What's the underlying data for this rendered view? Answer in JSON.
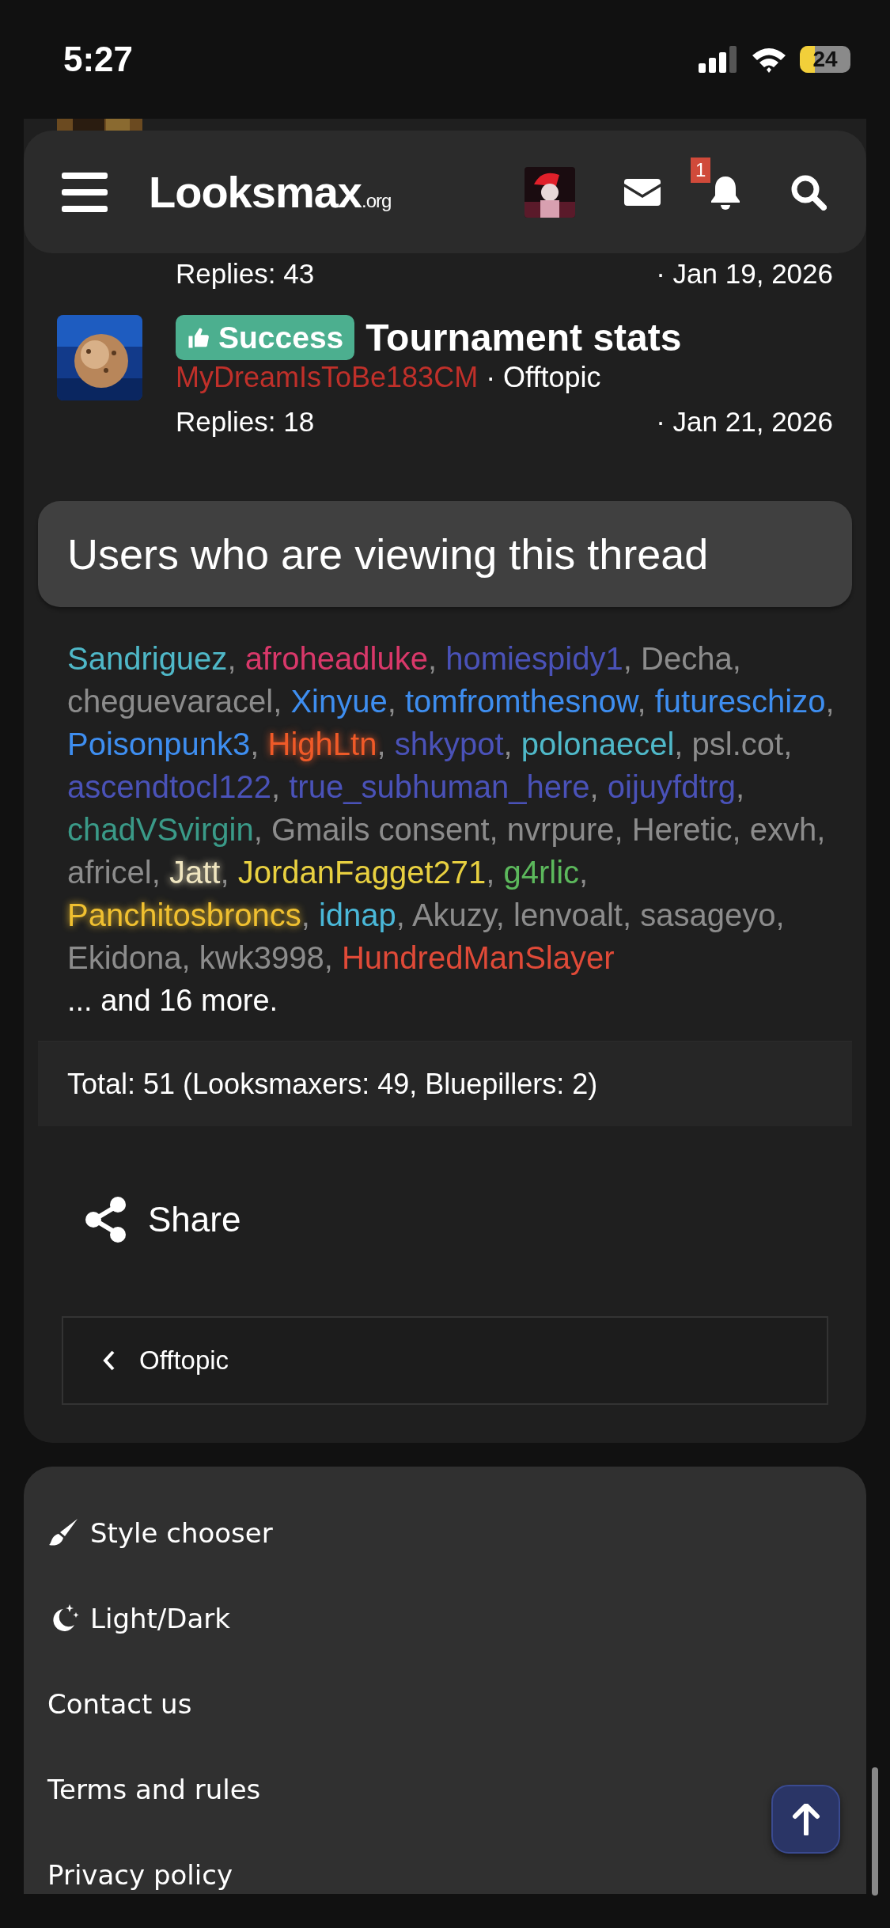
{
  "status_bar": {
    "time": "5:27",
    "battery": "24"
  },
  "header": {
    "logo": "Looksmax",
    "logo_suffix": ".org",
    "notification_count": "1"
  },
  "threads": [
    {
      "replies": "Replies: 43",
      "date": "· Jan 19, 2026"
    },
    {
      "badge": {
        "kind": "success",
        "label": "Success"
      },
      "title": "Tournament stats",
      "author": "MyDreamIsToBe183CM",
      "forum": "· Offtopic",
      "replies": "Replies: 18",
      "date": "· Jan 21, 2026"
    }
  ],
  "users_viewing": {
    "title": "Users who are viewing this thread",
    "separator": ",",
    "users": [
      {
        "name": "Sandriguez",
        "color": "#4fb8c8",
        "glow": false
      },
      {
        "name": "afroheadluke",
        "color": "#d9386a",
        "glow": false
      },
      {
        "name": "homiespidy1",
        "color": "#4a52b8",
        "glow": false
      },
      {
        "name": "Decha",
        "color": "#8c8c8c",
        "glow": false
      },
      {
        "name": "cheguevaracel",
        "color": "#8c8c8c",
        "glow": false
      },
      {
        "name": "Xinyue",
        "color": "#3e8ef0",
        "glow": false
      },
      {
        "name": "tomfromthesnow",
        "color": "#3e8ef0",
        "glow": false
      },
      {
        "name": "futureschizo",
        "color": "#3e8ef0",
        "glow": false
      },
      {
        "name": "Poisonpunk3",
        "color": "#3e8ef0",
        "glow": false
      },
      {
        "name": "HighLtn",
        "color": "#f05a28",
        "glow": true
      },
      {
        "name": "shkypot",
        "color": "#4a52b8",
        "glow": false
      },
      {
        "name": "polonaecel",
        "color": "#4fb8c8",
        "glow": false
      },
      {
        "name": "psl.cot",
        "color": "#8c8c8c",
        "glow": false
      },
      {
        "name": "ascendtocl122",
        "color": "#4a52b8",
        "glow": false
      },
      {
        "name": "true_subhuman_here",
        "color": "#4a52b8",
        "glow": false
      },
      {
        "name": "oijuyfdtrg",
        "color": "#4a52b8",
        "glow": false
      },
      {
        "name": "chadVSvirgin",
        "color": "#3a9a88",
        "glow": false
      },
      {
        "name": "Gmails consent",
        "color": "#8c8c8c",
        "glow": false
      },
      {
        "name": "nvrpure",
        "color": "#8c8c8c",
        "glow": false
      },
      {
        "name": "Heretic",
        "color": "#8c8c8c",
        "glow": false
      },
      {
        "name": "exvh",
        "color": "#8c8c8c",
        "glow": false
      },
      {
        "name": "africel",
        "color": "#8c8c8c",
        "glow": false
      },
      {
        "name": "Jatt",
        "color": "#f0e6c0",
        "glow": true
      },
      {
        "name": "JordanFagget271",
        "color": "#e8d040",
        "glow": false
      },
      {
        "name": "g4rlic",
        "color": "#5cb85c",
        "glow": false
      },
      {
        "name": "Panchitosbroncs",
        "color": "#f0c030",
        "glow": true
      },
      {
        "name": "idnap",
        "color": "#4ab8d8",
        "glow": false
      },
      {
        "name": "Akuzy",
        "color": "#8c8c8c",
        "glow": false
      },
      {
        "name": "lenvoalt",
        "color": "#8c8c8c",
        "glow": false
      },
      {
        "name": "sasageyo",
        "color": "#8c8c8c",
        "glow": false
      },
      {
        "name": "Ekidona",
        "color": "#8c8c8c",
        "glow": false
      },
      {
        "name": "kwk3998",
        "color": "#8c8c8c",
        "glow": false
      },
      {
        "name": "HundredManSlayer",
        "color": "#e04a38",
        "glow": false
      }
    ],
    "more": "... and 16 more.",
    "total": "Total: 51 (Looksmaxers: 49, Bluepillers: 2)"
  },
  "share": {
    "label": "Share"
  },
  "breadcrumb": {
    "label": "Offtopic"
  },
  "footer": [
    {
      "kind": "brush",
      "label": "Style chooser"
    },
    {
      "kind": "moon",
      "label": "Light/Dark"
    },
    {
      "kind": "plain",
      "label": "Contact us"
    },
    {
      "kind": "plain",
      "label": "Terms and rules"
    },
    {
      "kind": "plain",
      "label": "Privacy policy"
    }
  ]
}
